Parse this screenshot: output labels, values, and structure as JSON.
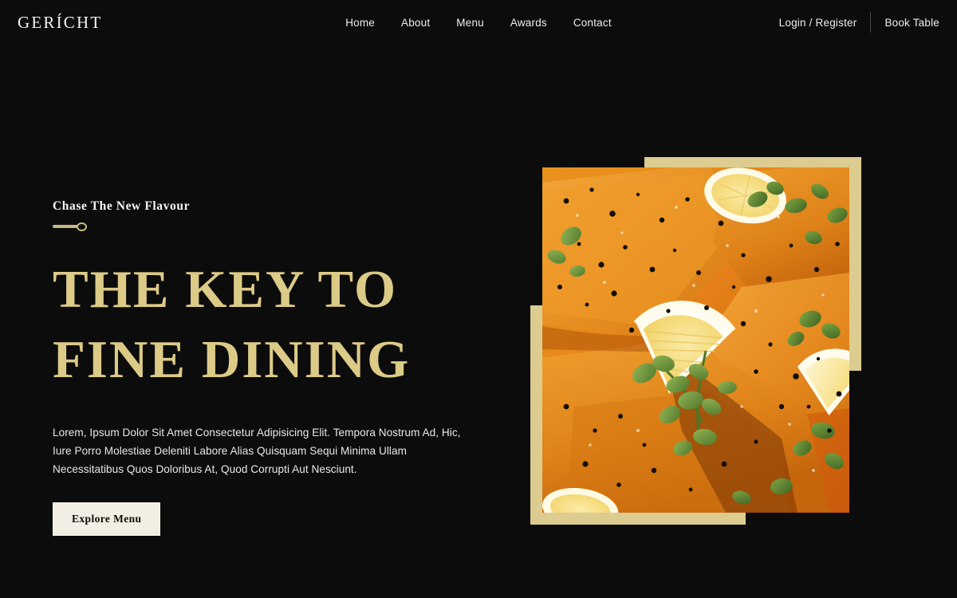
{
  "brand": {
    "name": "GERÍCHT"
  },
  "nav": {
    "links": [
      {
        "label": "Home"
      },
      {
        "label": "About"
      },
      {
        "label": "Menu"
      },
      {
        "label": "Awards"
      },
      {
        "label": "Contact"
      }
    ],
    "login_label": "Login / Register",
    "book_label": "Book Table"
  },
  "hero": {
    "subheading": "Chase The New Flavour",
    "headline_line1": "THE KEY TO",
    "headline_line2": "FINE DINING",
    "paragraph": "Lorem, Ipsum Dolor Sit Amet Consectetur Adipisicing Elit. Tempora Nostrum Ad, Hic, Iure Porro Molestiae Deleniti Labore Alias Quisquam Sequi Minima Ullam Necessitatibus Quos Doloribus At, Quod Corrupti Aut Nesciunt.",
    "cta_label": "Explore Menu",
    "image_alt": "salmon-fillets-in-creamy-orange-sauce-with-lemon-slices-and-herbs"
  },
  "colors": {
    "background": "#0C0C0C",
    "gold_accent": "#DCCA87",
    "gold_frame": "#DCCC8F",
    "cream_button": "#F3EEE3",
    "text_light": "#EDEDED"
  }
}
